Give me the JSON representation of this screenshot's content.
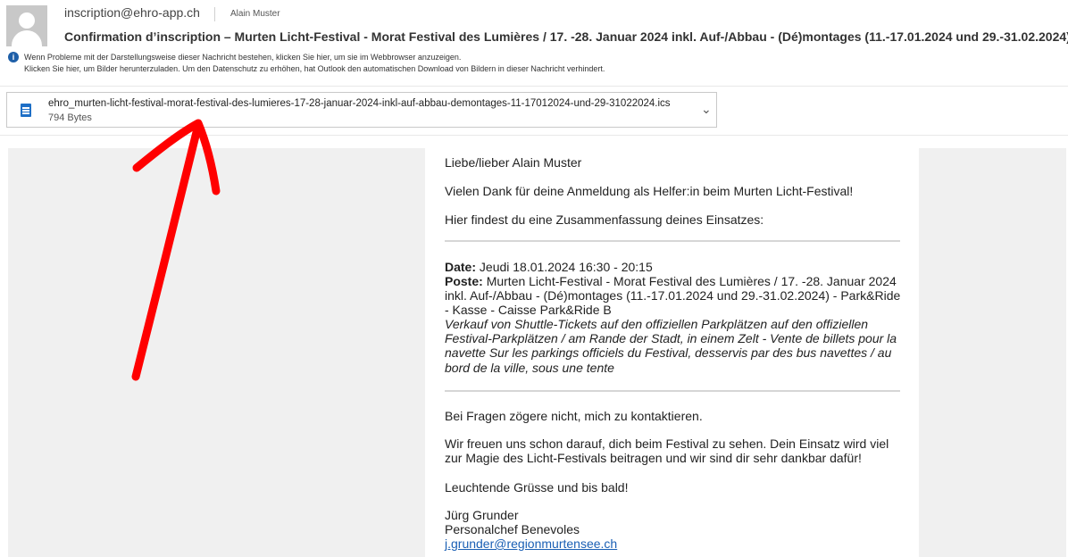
{
  "header": {
    "sender": "inscription@ehro-app.ch",
    "recipient": "Alain Muster",
    "subject": "Confirmation d’inscription – Murten Licht-Festival - Morat Festival des Lumières / 17. -28. Januar 2024 inkl. Auf-/Abbau - (Dé)montages (11.-17.01.2024 und 29.-31.02.2024)",
    "info_line1": "Wenn Probleme mit der Darstellungsweise dieser Nachricht bestehen, klicken Sie hier, um sie im Webbrowser anzuzeigen.",
    "info_line2": "Klicken Sie hier, um Bilder herunterzuladen. Um den Datenschutz zu erhöhen, hat Outlook den automatischen Download von Bildern in dieser Nachricht verhindert."
  },
  "attachment": {
    "filename": "ehro_murten-licht-festival-morat-festival-des-lumieres-17-28-januar-2024-inkl-auf-abbau-demontages-11-17012024-und-29-31022024.ics",
    "size": "794 Bytes"
  },
  "body": {
    "greeting": "Liebe/lieber Alain Muster",
    "thanks": "Vielen Dank für deine Anmeldung als Helfer:in beim Murten Licht-Festival!",
    "summary_intro": "Hier findest du eine Zusammenfassung deines Einsatzes:",
    "date_label": "Date:",
    "date_value": "Jeudi 18.01.2024 16:30 - 20:15",
    "poste_label": "Poste:",
    "poste_line1": "Murten Licht-Festival - Morat Festival des Lumières / 17. -28. Januar 2024",
    "poste_line2": "inkl. Auf-/Abbau - (Dé)montages (11.-17.01.2024 und 29.-31.02.2024) - Park&Ride",
    "poste_line3": "- Kasse - Caisse Park&Ride B",
    "desc_line1": "Verkauf von Shuttle-Tickets auf den offiziellen Parkplätzen auf den offiziellen",
    "desc_line2": "Festival-Parkplätzen / am Rande der Stadt, in einem Zelt - Vente de billets pour la",
    "desc_line3": "navette Sur les parkings officiels du Festival, desservis par des bus navettes / au",
    "desc_line4": "bord de la ville, sous une tente",
    "questions": "Bei Fragen zögere nicht, mich zu kontaktieren.",
    "looking_forward1": "Wir freuen uns schon darauf, dich beim Festival zu sehen. Dein Einsatz wird viel",
    "looking_forward2": "zur Magie des Licht-Festivals beitragen und wir sind dir sehr dankbar dafür!",
    "closing": "Leuchtende Grüsse und bis bald!",
    "signature_name": "Jürg Grunder",
    "signature_title": "Personalchef Benevoles",
    "signature_email": "j.grunder@regionmurtensee.ch"
  },
  "icons": {
    "avatar": "person-placeholder-icon",
    "info": "info-icon",
    "file": "calendar-file-icon",
    "expand": "chevron-down-icon"
  },
  "colors": {
    "arrow": "#ff0000",
    "link": "#1a5fb4",
    "info_icon": "#1e5fa8"
  }
}
